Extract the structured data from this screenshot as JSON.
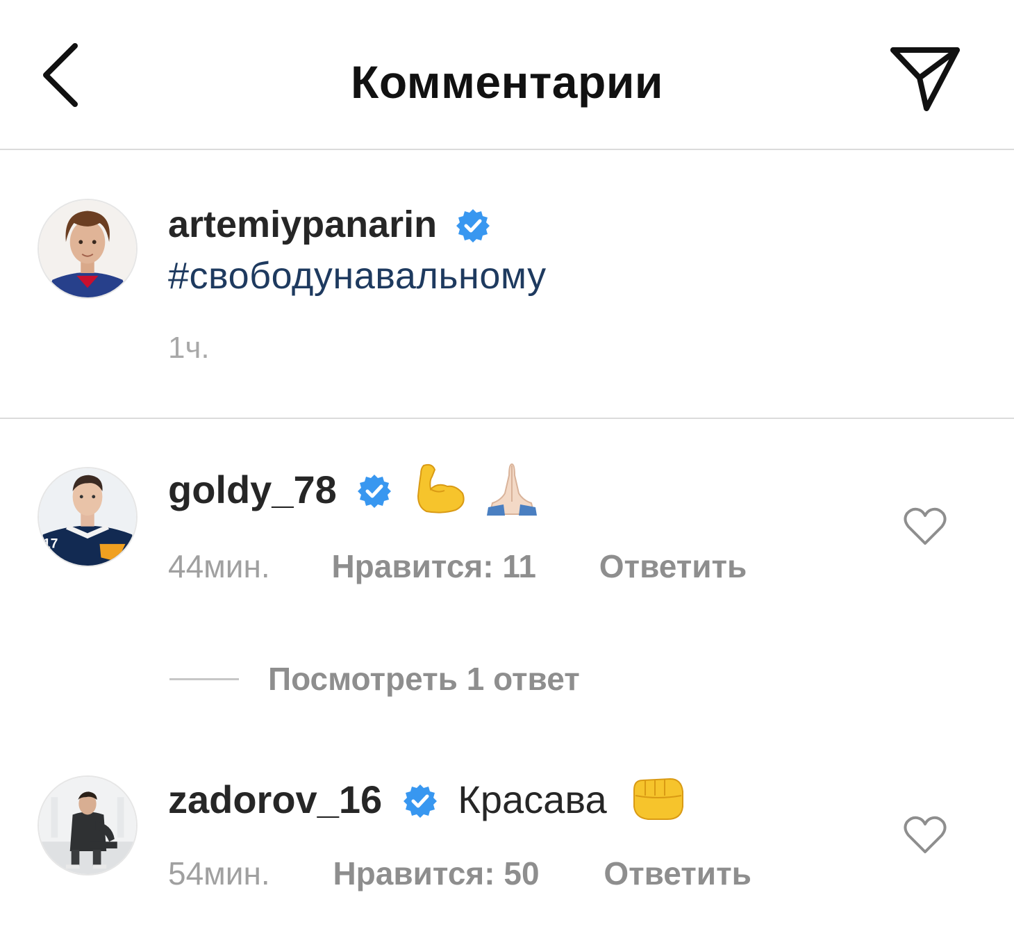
{
  "header": {
    "title": "Комментарии"
  },
  "caption": {
    "username": "artemiypanarin",
    "verified": true,
    "text": "#свободунавальному",
    "time": "1ч."
  },
  "comments": [
    {
      "username": "goldy_78",
      "verified": true,
      "text": "",
      "emojis": [
        "flexed-biceps",
        "folded-hands"
      ],
      "time": "44мин.",
      "likes": "Нравится: 11",
      "reply": "Ответить",
      "view_replies": "Посмотреть 1 ответ"
    },
    {
      "username": "zadorov_16",
      "verified": true,
      "text": "Красава",
      "emojis": [
        "oncoming-fist"
      ],
      "time": "54мин.",
      "likes": "Нравится: 50",
      "reply": "Ответить"
    }
  ],
  "colors": {
    "verified_blue": "#3897f0",
    "hashtag": "#1e3a5f",
    "muted_text": "#8e8e8e",
    "divider": "#dbdbdb"
  },
  "icons": {
    "back": "chevron-left-icon",
    "send": "paper-plane-icon",
    "like": "heart-outline-icon",
    "verified": "verified-badge-icon"
  }
}
